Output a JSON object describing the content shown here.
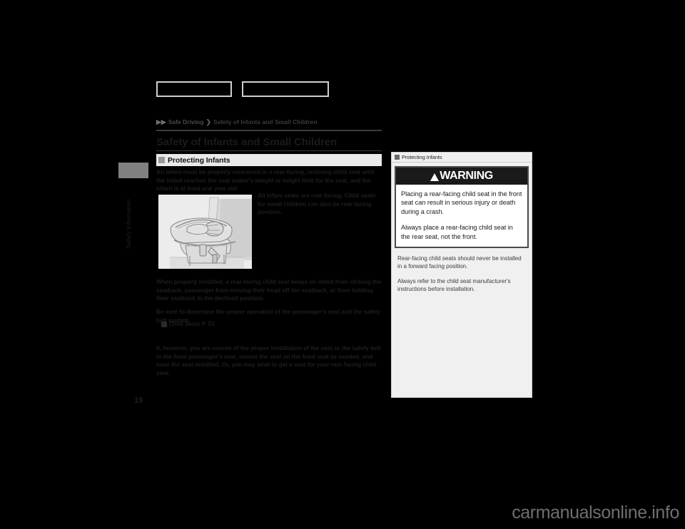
{
  "document": {
    "page_number": "19",
    "watermark": "carmanualsonline.info"
  },
  "side_tab": {
    "label": "Safety Information"
  },
  "breadcrumb": {
    "arrow": "▶▶",
    "items": [
      "Safe Driving",
      "Safety of Infants and Small Children"
    ],
    "separator": "❯"
  },
  "heading": {
    "title": "Safety of Infants and Small Children"
  },
  "section": {
    "icon": "square-bullet-icon",
    "label": "Protecting Infants"
  },
  "main": {
    "paragraph_intro": "An infant must be properly restrained in a rear-facing, reclining child seat until the infant reaches the seat maker's weight or height limit for the seat, and the infant is at least one year old.",
    "illustration_caption": "All infant seats are rear-facing. Child seats for small children can also be rear-facing position.",
    "paragraph_secure": "When properly installed, a rear-facing child seat keeps an infant from striking the seatback, passenger from moving their head off the seatback, or from holding their seatback in the declined position.",
    "paragraph_learn": "Be sure to determine the proper operation of the passenger's seat and the safety belt system.",
    "page_ref": {
      "icon": "page-reference-icon",
      "label": "Child Seats P. 53"
    },
    "paragraph_last": "If, however, you are unsure of the proper installation of the seat or the safety belt in the front passenger's seat, secure the seat on the front seat as needed, and have the seat installed. Or, you may wish to get a seat for your rear-facing child seat."
  },
  "sidebar": {
    "header": {
      "icon": "square-bullet-icon",
      "label": "Protecting Infants"
    },
    "warning": {
      "icon": "warning-triangle-icon",
      "title": "WARNING",
      "paragraph_1": "Placing a rear-facing child seat in the front seat can result in serious injury or death during a crash.",
      "paragraph_2": "Always place a rear-facing child seat in the rear seat, not the front."
    },
    "notes": [
      "Rear-facing child seats should never be installed in a forward facing position.",
      "Always refer to the child seat manufacturer's instructions before installation."
    ]
  },
  "redacted_bars": {
    "left": "",
    "right": ""
  }
}
